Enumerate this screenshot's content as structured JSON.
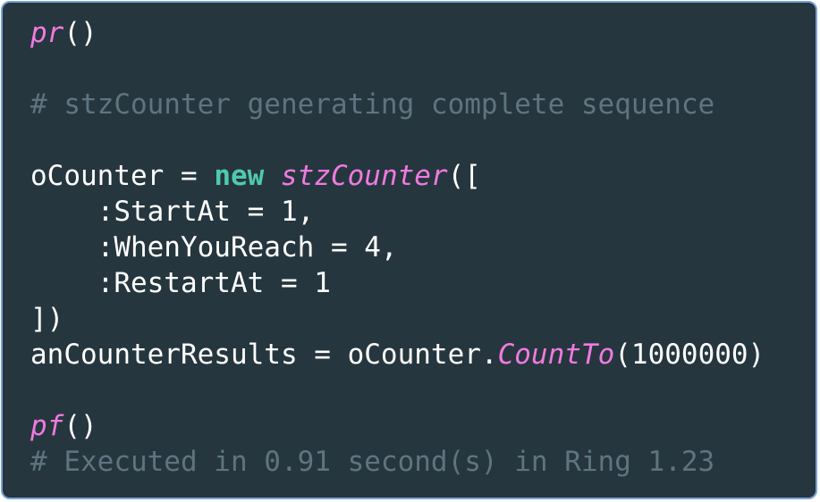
{
  "code_lines": [
    [
      {
        "t": "pr",
        "k": "fn"
      },
      {
        "t": "()",
        "k": "plain"
      }
    ],
    [],
    [
      {
        "t": "# stzCounter generating complete sequence",
        "k": "comment"
      }
    ],
    [],
    [
      {
        "t": "oCounter = ",
        "k": "plain"
      },
      {
        "t": "new",
        "k": "kw"
      },
      {
        "t": " ",
        "k": "plain"
      },
      {
        "t": "stzCounter",
        "k": "fn"
      },
      {
        "t": "([",
        "k": "plain"
      }
    ],
    [
      {
        "t": "    :StartAt = 1,",
        "k": "plain"
      }
    ],
    [
      {
        "t": "    :WhenYouReach = 4,",
        "k": "plain"
      }
    ],
    [
      {
        "t": "    :RestartAt = 1",
        "k": "plain"
      }
    ],
    [
      {
        "t": "])",
        "k": "plain"
      }
    ],
    [
      {
        "t": "anCounterResults = oCounter.",
        "k": "plain"
      },
      {
        "t": "CountTo",
        "k": "fn"
      },
      {
        "t": "(1000000)",
        "k": "plain"
      }
    ],
    [],
    [
      {
        "t": "pf",
        "k": "fn"
      },
      {
        "t": "()",
        "k": "plain"
      }
    ],
    [
      {
        "t": "# Executed in 0.91 second(s) in Ring 1.23",
        "k": "comment"
      }
    ]
  ],
  "colors": {
    "background": "#26363e",
    "border": "#7aa3d6",
    "function": "#f07adf",
    "keyword": "#4fc9b0",
    "comment": "#5d7580",
    "plain": "#ffffff"
  }
}
